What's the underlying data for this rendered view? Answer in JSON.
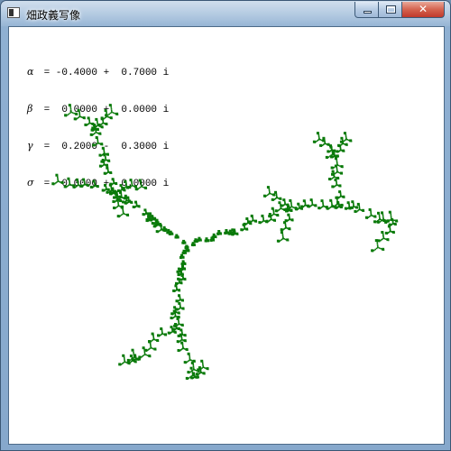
{
  "window": {
    "title": "畑政義写像",
    "buttons": {
      "minimize": "minimize",
      "maximize": "maximize",
      "close": "close"
    }
  },
  "params": [
    {
      "symbol": "α",
      "text": " = -0.4000 +  0.7000 i"
    },
    {
      "symbol": "β",
      "text": " =  0.0000 +  0.0000 i"
    },
    {
      "symbol": "γ",
      "text": " =  0.2000 -  0.3000 i"
    },
    {
      "symbol": "σ",
      "text": " =  0.0000 +  0.0000 i"
    }
  ],
  "colors": {
    "fractal": "#0a7a0a",
    "background": "#ffffff"
  },
  "icons": [
    "app-icon",
    "minimize-icon",
    "maximize-icon",
    "close-icon"
  ]
}
